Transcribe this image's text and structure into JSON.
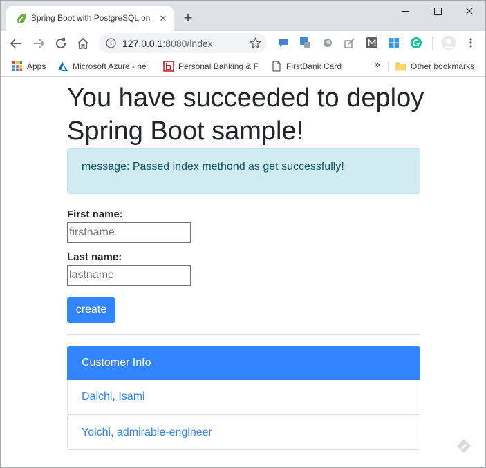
{
  "browser": {
    "tab_title": "Spring Boot with PostgreSQL on",
    "url_host": "127.0.0.1",
    "url_rest": ":8080/index"
  },
  "bookmarks": {
    "apps": "Apps",
    "azure": "Microsoft Azure - ne",
    "banking": "Personal Banking & F",
    "firstbank": "FirstBank Card",
    "more": "»",
    "other": "Other bookmarks"
  },
  "page": {
    "heading": "You have succeeded to deploy Spring Boot sample!",
    "alert_message": "message: Passed index methond as get successfully!",
    "form": {
      "first_label": "First name:",
      "first_placeholder": "firstname",
      "last_label": "Last name:",
      "last_placeholder": "lastname",
      "submit_label": "create"
    },
    "customers": {
      "header": "Customer Info",
      "items": [
        "Daichi, Isami",
        "Yoichi, admirable-engineer"
      ]
    }
  },
  "colors": {
    "primary": "#3385ff",
    "alert_bg": "#d1ecf1",
    "alert_text": "#0c5460"
  }
}
